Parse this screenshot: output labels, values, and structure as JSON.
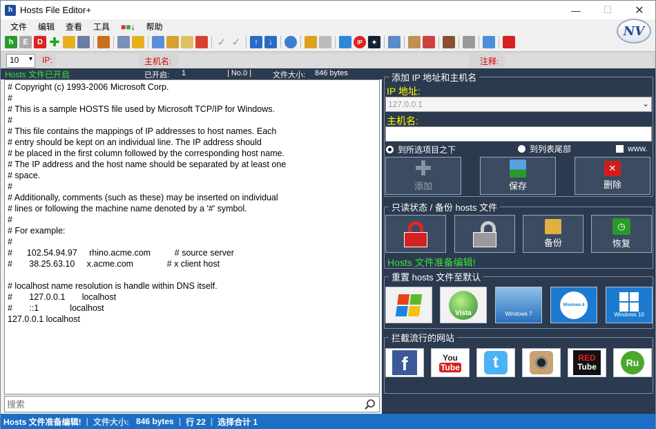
{
  "window": {
    "title": "Hosts File Editor+",
    "icon_text": "h"
  },
  "logo_text": "NV",
  "menu": [
    "文件",
    "编辑",
    "查看",
    "工具",
    "",
    "帮助"
  ],
  "inputs": {
    "count": "10",
    "ip_label": "IP:",
    "hostname_label": "主机名:",
    "comment_label": "注释:"
  },
  "strip": {
    "status": "Hosts 文件已开启",
    "opened_label": "已开启:",
    "opened_value": "1",
    "no_label": "| No.0 |",
    "size_label": "文件大小:",
    "size_value": "846 bytes"
  },
  "editor_lines": [
    "# Copyright (c) 1993-2006 Microsoft Corp.",
    "#",
    "# This is a sample HOSTS file used by Microsoft TCP/IP for Windows.",
    "#",
    "# This file contains the mappings of IP addresses to host names. Each",
    "# entry should be kept on an individual line. The IP address should",
    "# be placed in the first column followed by the corresponding host name.",
    "# The IP address and the host name should be separated by at least one",
    "# space.",
    "#",
    "# Additionally, comments (such as these) may be inserted on individual",
    "# lines or following the machine name denoted by a '#' symbol.",
    "#",
    "# For example:",
    "#",
    "#      102.54.94.97     rhino.acme.com          # source server",
    "#       38.25.63.10     x.acme.com              # x client host",
    "",
    "# localhost name resolution is handle within DNS itself.",
    "#       127.0.0.1       localhost",
    "#       ::1             localhost",
    "127.0.0.1 localhost"
  ],
  "search": {
    "placeholder": "搜索"
  },
  "add_group": {
    "title": "添加 IP 地址和主机名",
    "ip_label": "IP 地址:",
    "ip_value": "127.0.0.1",
    "host_label": "主机名:",
    "host_value": "",
    "radio_top": "到所选项目之下",
    "radio_bottom": "到列表尾部",
    "www_label": "www.",
    "add_label": "添加",
    "save_label": "保存",
    "delete_label": "删除"
  },
  "readonly_group": {
    "title": "只读状态 / 备份 hosts 文件",
    "backup_label": "备份",
    "restore_label": "恢复",
    "ready_text": "Hosts 文件准备编辑!"
  },
  "reset_group": {
    "title": "重置 hosts 文件至默认",
    "xp": "Windows XP",
    "vista": "Vista",
    "w7": "Windows 7",
    "w8": "Windows 8",
    "w10": "Windows 10"
  },
  "block_group": {
    "title": "拦截流行的网站",
    "youtube_a": "You",
    "youtube_b": "Tube",
    "redtube_a": "RED",
    "redtube_b": "Tube",
    "ru": "Ru",
    "facebook": "f"
  },
  "statusbar": {
    "ready": "Hosts 文件准备编辑!",
    "size_label": "文件大小:",
    "size_value": "846 bytes",
    "line": "行 22",
    "selection": "选择合计 1"
  }
}
